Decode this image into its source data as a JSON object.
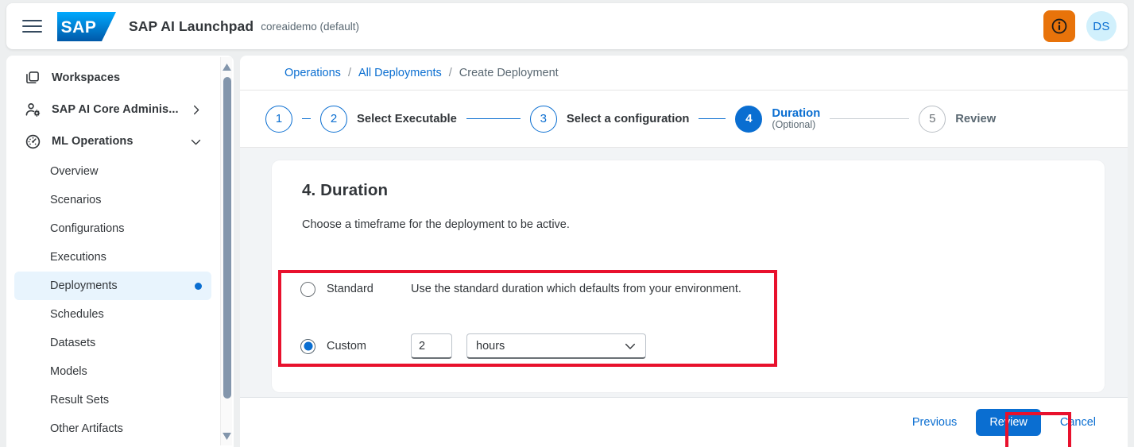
{
  "shellbar": {
    "menu_icon": "hamburger-menu-icon",
    "logo": "sap-logo",
    "logo_text": "SAP",
    "title": "SAP AI Launchpad",
    "subtitle": "coreaidemo (default)",
    "info_icon": "info-icon",
    "avatar_initials": "DS"
  },
  "sidebar": {
    "groups": [
      {
        "label": "Workspaces",
        "icon": "workspaces-icon",
        "chevron": ""
      },
      {
        "label": "SAP AI Core Adminis...",
        "icon": "user-settings-icon",
        "chevron": "chevron-right-icon"
      },
      {
        "label": "ML Operations",
        "icon": "ml-operations-icon",
        "chevron": "chevron-down-icon"
      }
    ],
    "items": [
      {
        "label": "Overview",
        "selected": false
      },
      {
        "label": "Scenarios",
        "selected": false
      },
      {
        "label": "Configurations",
        "selected": false
      },
      {
        "label": "Executions",
        "selected": false
      },
      {
        "label": "Deployments",
        "selected": true
      },
      {
        "label": "Schedules",
        "selected": false
      },
      {
        "label": "Datasets",
        "selected": false
      },
      {
        "label": "Models",
        "selected": false
      },
      {
        "label": "Result Sets",
        "selected": false
      },
      {
        "label": "Other Artifacts",
        "selected": false
      }
    ],
    "scrollbar": {
      "up_icon": "scroll-up-arrow-icon",
      "down_icon": "scroll-down-arrow-icon"
    }
  },
  "breadcrumb": {
    "first": "Operations",
    "second": "All Deployments",
    "current": "Create Deployment",
    "separator": "/"
  },
  "wizard": {
    "steps": [
      {
        "number": "1",
        "title": "",
        "optional": "",
        "state": "done"
      },
      {
        "number": "2",
        "title": "Select Executable",
        "optional": "",
        "state": "done"
      },
      {
        "number": "3",
        "title": "Select a configuration",
        "optional": "",
        "state": "done"
      },
      {
        "number": "4",
        "title": "Duration",
        "optional": "(Optional)",
        "state": "active"
      },
      {
        "number": "5",
        "title": "Review",
        "optional": "",
        "state": "todo"
      }
    ]
  },
  "main": {
    "heading": "4. Duration",
    "description": "Choose a timeframe for the deployment to be active.",
    "options": {
      "standard": {
        "label": "Standard",
        "hint": "Use the standard duration which defaults from your environment.",
        "selected": false
      },
      "custom": {
        "label": "Custom",
        "selected": true,
        "amount_value": "2",
        "unit_value": "hours",
        "unit_chevron": "chevron-down-icon"
      }
    }
  },
  "footer": {
    "previous_label": "Previous",
    "review_label": "Review",
    "cancel_label": "Cancel"
  },
  "annotations": {
    "duration_box": "red-highlight-duration-options",
    "review_box": "red-highlight-review-button"
  },
  "colors": {
    "brand_blue": "#0a6ed1",
    "info_orange": "#e8730a",
    "highlight_red": "#e8112d",
    "selected_bg": "#e8f4fd",
    "page_bg": "#f2f4f6"
  }
}
